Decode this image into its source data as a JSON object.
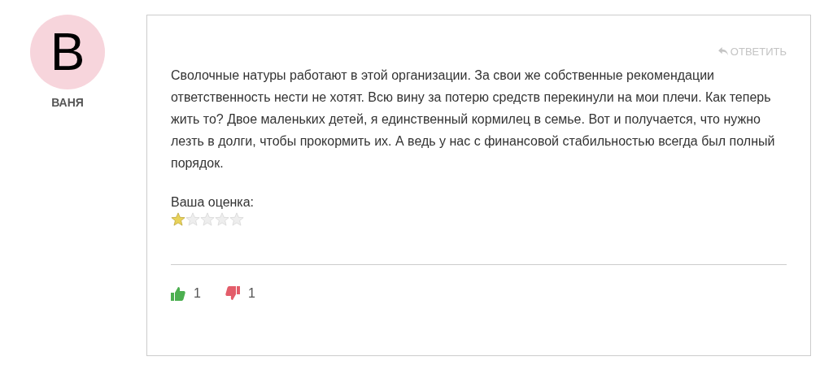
{
  "author": {
    "initial": "В",
    "name": "ВАНЯ"
  },
  "reply": "ОТВЕТИТЬ",
  "text": "Сволочные натуры работают в этой организации. За свои же собственные рекомендации ответственность нести не хотят. Всю вину за потерю средств перекинули на мои плечи. Как теперь жить то? Двое маленьких детей, я единственный кормилец в семье. Вот и получается, что нужно лезть в долги, чтобы прокормить их. А ведь у нас с финансовой стабильностью всегда был полный порядок.",
  "rating": {
    "label": "Ваша оценка:",
    "stars": 1
  },
  "votes": {
    "likes": "1",
    "dislikes": "1"
  }
}
